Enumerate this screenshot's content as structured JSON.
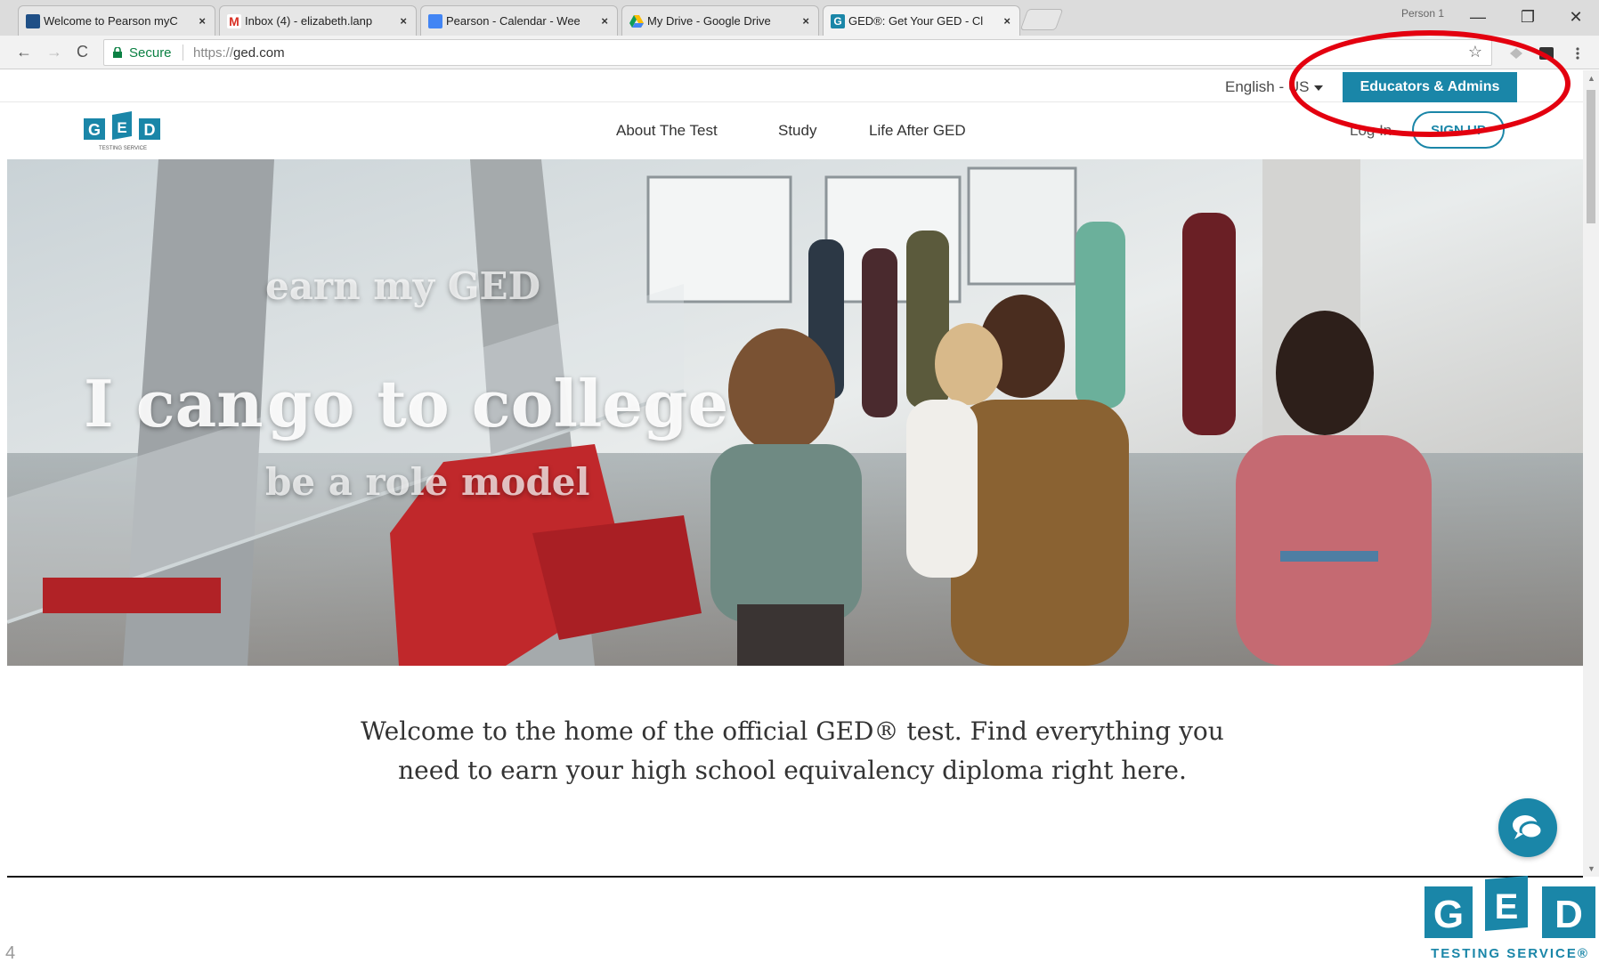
{
  "browser": {
    "tabs": [
      {
        "title": "Welcome to Pearson myC",
        "close": "×",
        "favicon_color": "#1f4f86"
      },
      {
        "title": "Inbox (4) - elizabeth.lanp",
        "close": "×",
        "favicon_color": "#d93025"
      },
      {
        "title": "Pearson - Calendar - Wee",
        "close": "×",
        "favicon_color": "#4285f4"
      },
      {
        "title": "My Drive - Google Drive",
        "close": "×",
        "favicon_color": "#0f9d58"
      },
      {
        "title": "GED®: Get Your GED - Cl",
        "close": "×",
        "favicon_color": "#1a86a8"
      }
    ],
    "profile_label": "Person 1",
    "window_controls": {
      "minimize": "—",
      "restore": "❐",
      "close": "✕"
    },
    "nav": {
      "back": "←",
      "forward": "→",
      "reload": "C"
    },
    "address": {
      "secure_label": "Secure",
      "scheme": "https://",
      "host": "ged.com",
      "star": "☆"
    }
  },
  "page": {
    "utility": {
      "language": "English - US",
      "educators_button": "Educators & Admins"
    },
    "nav": {
      "links": [
        "About The Test",
        "Study",
        "Life After GED"
      ],
      "login": "Log In",
      "signup": "SIGN UP"
    },
    "logo": {
      "letters": [
        "G",
        "E",
        "D"
      ],
      "tagline": "TESTING SERVICE"
    },
    "hero": {
      "line_small_1": "earn my GED",
      "line_big_prefix": "I can",
      "line_big": "go to college",
      "line_small_2": "be a role model"
    },
    "welcome": {
      "line1": "Welcome to the home of the official GED® test. Find everything you",
      "line2": "need to earn your high school equivalency diploma right here."
    }
  },
  "slide": {
    "page_number": "4",
    "logo": {
      "letters": [
        "G",
        "E",
        "D"
      ],
      "tagline": "TESTING SERVICE®"
    }
  },
  "colors": {
    "brand": "#1a86a8",
    "highlight": "#e3000f"
  }
}
